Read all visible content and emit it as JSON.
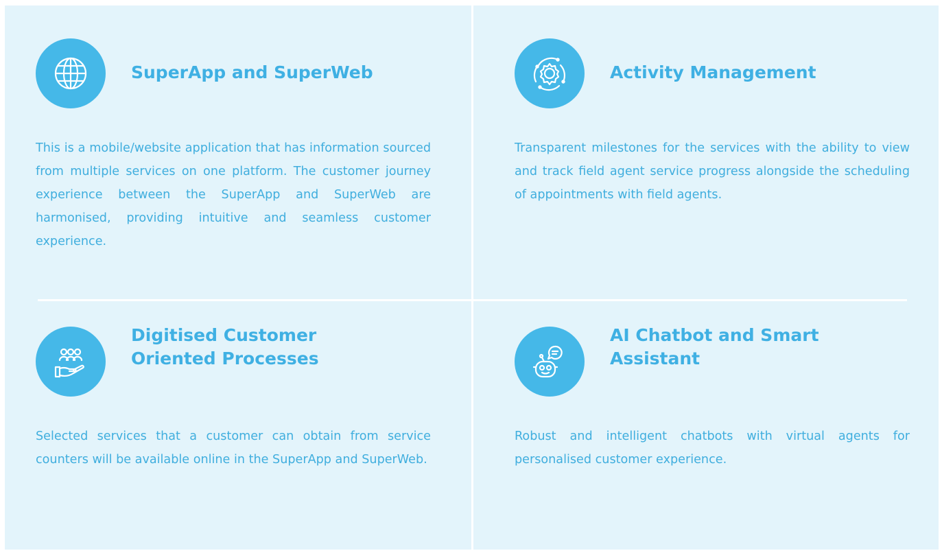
{
  "features": [
    {
      "icon": "globe-icon",
      "title": "SuperApp and SuperWeb",
      "description": "This is a mobile/website application that has information sourced from multiple services on one platform. The customer journey experience between the SuperApp and SuperWeb are harmonised, providing intuitive and seamless customer experience."
    },
    {
      "icon": "gear-cycle-icon",
      "title": "Activity Management",
      "description": "Transparent milestones for the services with the ability to view and track field agent service progress alongside the scheduling of appointments with field agents."
    },
    {
      "icon": "hand-people-icon",
      "title": "Digitised Customer Oriented Processes",
      "description": "Selected services that a customer can obtain from service counters will be available online in the SuperApp and SuperWeb."
    },
    {
      "icon": "chatbot-icon",
      "title": "AI Chatbot and Smart Assistant",
      "description": "Robust and intelligent chatbots with virtual agents for personalised customer experience."
    }
  ],
  "colors": {
    "accent": "#45b8e8",
    "title_text": "#3fb0e3",
    "body_text": "#40aede",
    "panel_background": "#e3f4fb",
    "divider": "#ffffff"
  }
}
